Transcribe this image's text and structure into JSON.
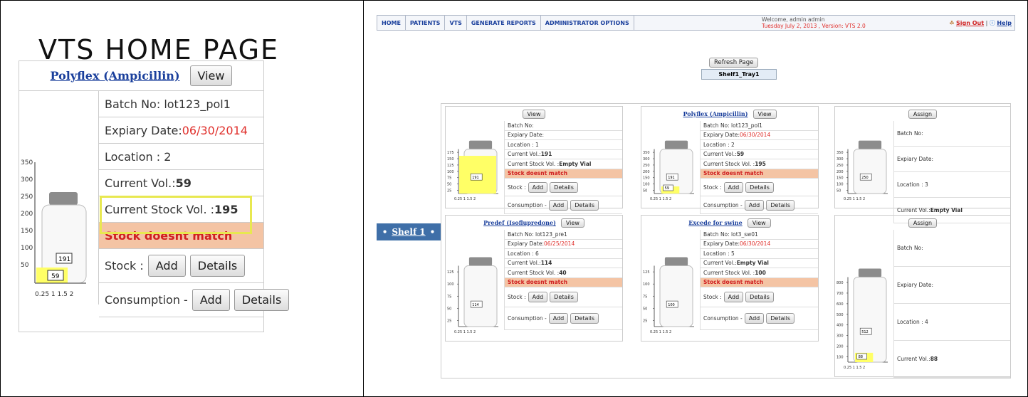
{
  "left": {
    "title": "VTS HOME PAGE",
    "drug_link": "Polyflex (Ampicillin)",
    "view_button": "View",
    "batch": "Batch No: lot123_pol1",
    "expiry_label": "Expiary Date: ",
    "expiry_value": "06/30/2014",
    "location": "Location : 2",
    "current_vol_label": "Current Vol.: ",
    "current_vol_value": "59",
    "stock_vol_label": "Current Stock Vol. : ",
    "stock_vol_value": "195",
    "warning": "Stock doesnt match",
    "stock_label": "Stock : ",
    "consumption_label": "Consumption - ",
    "add": "Add",
    "details": "Details",
    "vial": {
      "ticks": [
        "350",
        "300",
        "250",
        "200",
        "150",
        "100",
        "50"
      ],
      "xticks": "0.25  1 1.5 2",
      "stock_box": "191",
      "current_box": "59"
    }
  },
  "nav": {
    "items": [
      "HOME",
      "PATIENTS",
      "VTS",
      "GENERATE REPORTS",
      "ADMINISTRATOR OPTIONS"
    ],
    "welcome": "Welcome, admin admin",
    "date": "Tuesday July 2, 2013 , Version: VTS 2.0",
    "sign_out": "Sign Out",
    "sep": " | ",
    "help": "Help"
  },
  "refresh_button": "Refresh Page",
  "tray_label": "Shelf1_Tray1",
  "shelf_label": "Shelf 1",
  "cells": {
    "c1": {
      "view": "View",
      "batch": "Batch No:",
      "expiry": "Expiary Date:",
      "location": "Location : 1",
      "cur_label": "Current Vol.: ",
      "cur": "191",
      "stock_label": "Current Stock Vol. : ",
      "stock": "Empty Vial",
      "warning": "Stock doesnt match",
      "stock_row": "Stock : ",
      "cons_row": "Consumption - ",
      "add": "Add",
      "details": "Details"
    },
    "c2": {
      "link": "Polyflex (Ampicillin)",
      "view": "View",
      "batch": "Batch No: lot123_pol1",
      "expiry_label": "Expiary Date: ",
      "expiry": "06/30/2014",
      "location": "Location : 2",
      "cur_label": "Current Vol.: ",
      "cur": "59",
      "stock_label": "Current Stock Vol. : ",
      "stock": "195",
      "warning": "Stock doesnt match",
      "stock_row": "Stock : ",
      "cons_row": "Consumption - ",
      "add": "Add",
      "details": "Details"
    },
    "c3": {
      "assign": "Assign",
      "batch": "Batch No:",
      "expiry": "Expiary Date:",
      "location": "Location : 3",
      "cur_label": "Current Vol.: ",
      "cur": "Empty Vial"
    },
    "c4": {
      "link": "Predef (Isoflupredone)",
      "view": "View",
      "batch": "Batch No: lot123_pre1",
      "expiry_label": "Expiary Date: ",
      "expiry": "06/25/2014",
      "location": "Location : 6",
      "cur_label": "Current Vol.: ",
      "cur": "114",
      "stock_label": "Current Stock Vol. : ",
      "stock": "40",
      "warning": "Stock doesnt match",
      "stock_row": "Stock : ",
      "cons_row": "Consumption - ",
      "add": "Add",
      "details": "Details"
    },
    "c5": {
      "link": "Excede for swine",
      "view": "View",
      "batch": "Batch No: lot3_sw01",
      "expiry_label": "Expiary Date: ",
      "expiry": "06/30/2014",
      "location": "Location : 5",
      "cur_label": "Current Vol.: ",
      "cur": "Empty Vial",
      "stock_label": "Current Stock Vol. : ",
      "stock": "100",
      "warning": "Stock doesnt match",
      "stock_row": "Stock : ",
      "cons_row": "Consumption - ",
      "add": "Add",
      "details": "Details"
    },
    "c6": {
      "assign": "Assign",
      "batch": "Batch No:",
      "expiry": "Expiary Date:",
      "location": "Location : 4",
      "cur_label": "Current Vol.: ",
      "cur": "88"
    }
  },
  "vials": {
    "v1": {
      "ticks": [
        "175",
        "150",
        "125",
        "100",
        "75",
        "50",
        "25"
      ],
      "box": "191",
      "xticks": "0.25  1 1.5 2"
    },
    "v2": {
      "ticks": [
        "350",
        "300",
        "250",
        "200",
        "150",
        "100",
        "50"
      ],
      "box": "191",
      "box2": "59",
      "xticks": "0.25  1 1.5 2"
    },
    "v3": {
      "ticks": [
        "350",
        "300",
        "250",
        "200",
        "150",
        "100",
        "50"
      ],
      "box": "250",
      "xticks": "0.25  1 1.5 2"
    },
    "v4": {
      "ticks": [
        "125",
        "100",
        "75",
        "50",
        "25"
      ],
      "box": "114",
      "xticks": "0.25  1 1.5 2"
    },
    "v5": {
      "ticks": [
        "125",
        "100",
        "75",
        "50",
        "25"
      ],
      "box": "100",
      "xticks": "0.25  1 1.5 2"
    },
    "v6": {
      "ticks": [
        "800",
        "700",
        "600",
        "500",
        "400",
        "300",
        "200",
        "100"
      ],
      "box": "512",
      "box2": "88",
      "xticks": "0.25  1 1.5 2"
    }
  },
  "colors": {
    "accent": "#3f6fa8",
    "warning_bg": "#f4c4a4",
    "warning_text": "#d02020",
    "liquid": "#ffff66",
    "highlight": "#e8e850"
  }
}
